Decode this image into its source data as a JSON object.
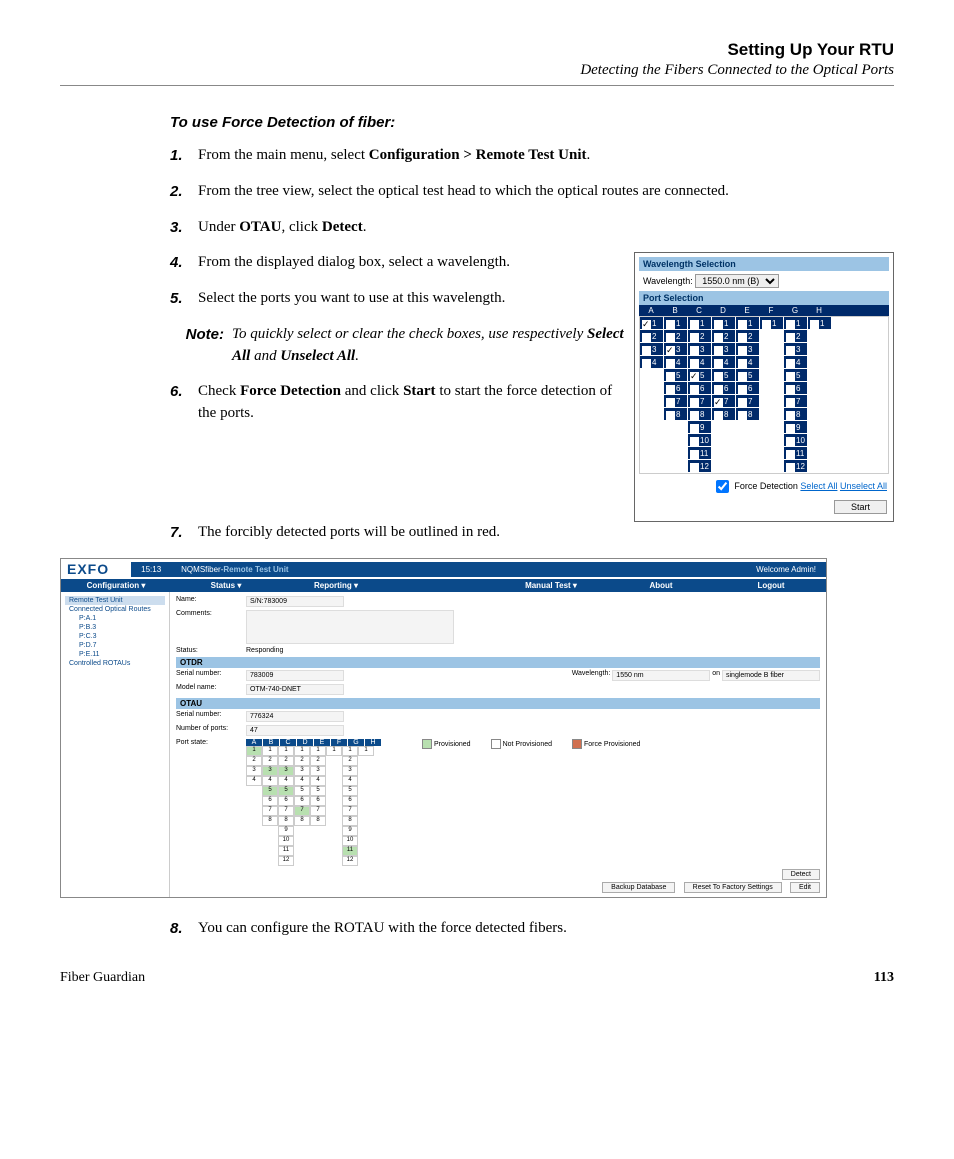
{
  "header": {
    "chapter": "Setting Up Your RTU",
    "section": "Detecting the Fibers Connected to the Optical Ports"
  },
  "procedure_title": "To use Force Detection of fiber:",
  "steps": {
    "s1": {
      "n": "1.",
      "pre": "From the main menu, select ",
      "b1": "Configuration > Remote Test Unit",
      "post": "."
    },
    "s2": {
      "n": "2.",
      "text": "From the tree view, select the optical test head to which the optical routes are connected."
    },
    "s3": {
      "n": "3.",
      "pre": "Under ",
      "b1": "OTAU",
      "mid": ", click ",
      "b2": "Detect",
      "post": "."
    },
    "s4": {
      "n": "4.",
      "text": "From the displayed dialog box, select a wavelength."
    },
    "s5": {
      "n": "5.",
      "text": "Select the ports you want to use at this wavelength."
    },
    "s6": {
      "n": "6.",
      "pre": "Check ",
      "b1": "Force Detection",
      "mid": " and click ",
      "b2": "Start",
      "post": " to start the force detection of the ports."
    },
    "s7": {
      "n": "7.",
      "text": "The forcibly detected ports will be outlined in red."
    },
    "s8": {
      "n": "8.",
      "text": "You can configure the ROTAU with the force detected fibers."
    }
  },
  "note": {
    "label": "Note:",
    "pre": "To quickly select or clear the check boxes, use respectively ",
    "b1": "Select All",
    "mid": " and ",
    "b2": "Unselect All",
    "post": "."
  },
  "dialog": {
    "wave_hdr": "Wavelength Selection",
    "wave_lbl": "Wavelength:",
    "wave_val": "1550.0 nm (B)",
    "port_hdr": "Port Selection",
    "cols": [
      "A",
      "B",
      "C",
      "D",
      "E",
      "F",
      "G",
      "H"
    ],
    "fd_label": "Force Detection",
    "sel_all": "Select All",
    "unsel_all": "Unselect All",
    "start": "Start"
  },
  "app": {
    "logo": "EXFO",
    "time": "15:13",
    "bc_app": "NQMSfiber",
    "bc_sep": " - ",
    "bc_page": "Remote Test Unit",
    "welcome": "Welcome Admin!",
    "menu": [
      "Configuration ▾",
      "Status ▾",
      "Reporting ▾",
      "Manual Test ▾",
      "About",
      "Logout"
    ],
    "tree": {
      "root": "Remote Test Unit",
      "grp1": "Connected Optical Routes",
      "items": [
        "P:A.1",
        "P:B.3",
        "P:C.3",
        "P:D.7",
        "P:E.11"
      ],
      "grp2": "Controlled ROTAUs"
    },
    "fields": {
      "name_lbl": "Name:",
      "name_val": "S/N:783009",
      "comments_lbl": "Comments:",
      "status_lbl": "Status:",
      "status_val": "Responding",
      "otdr_hdr": "OTDR",
      "sn_lbl": "Serial number:",
      "sn_val": "783009",
      "model_lbl": "Model name:",
      "model_val": "OTM-740-DNET",
      "wl_lbl": "Wavelength:",
      "wl_val": "1550 nm",
      "wl_on": "on",
      "wl_fiber": "singlemode B fiber",
      "otau_hdr": "OTAU",
      "otau_sn_val": "776324",
      "nports_lbl": "Number of ports:",
      "nports_val": "47",
      "pstate_lbl": "Port state:"
    },
    "legend": {
      "p": "Provisioned",
      "n": "Not Provisioned",
      "f": "Force Provisioned"
    },
    "buttons": {
      "detect": "Detect",
      "backup": "Backup Database",
      "reset": "Reset To Factory Settings",
      "edit": "Edit"
    }
  },
  "footer": {
    "product": "Fiber Guardian",
    "page": "113"
  }
}
